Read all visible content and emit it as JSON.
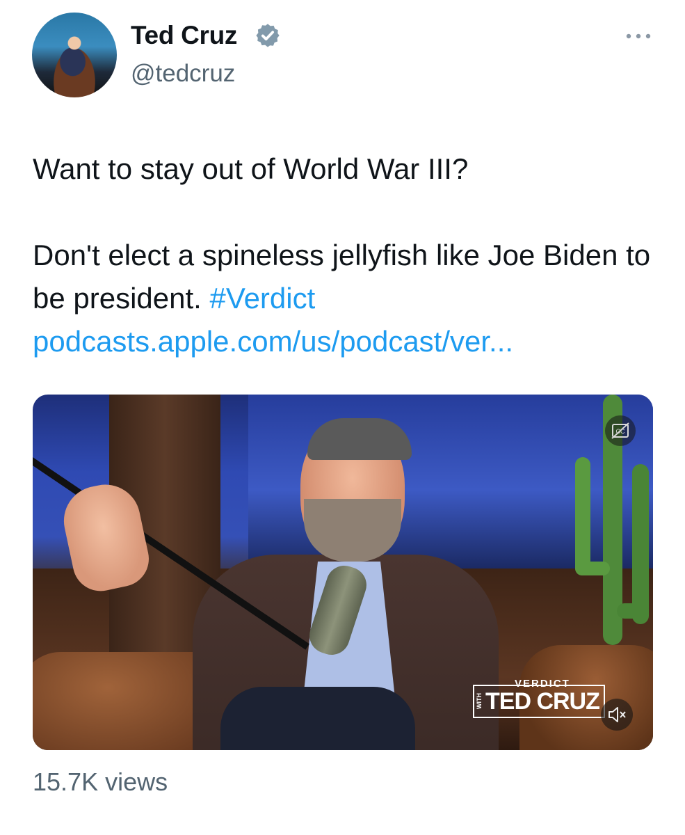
{
  "author": {
    "display_name": "Ted Cruz",
    "handle": "@tedcruz",
    "verified_icon": "verified-badge-icon",
    "avatar_icon": "profile-photo"
  },
  "menu": {
    "more_icon": "more-horizontal-icon"
  },
  "tweet": {
    "text_line1": "Want to stay out of World War III?",
    "text_line2": "Don't elect a spineless jellyfish like Joe Biden to be president.",
    "hashtag": "#Verdict",
    "link": "podcasts.apple.com/us/podcast/ver..."
  },
  "media": {
    "type": "video",
    "logo_top": "VERDICT",
    "logo_side": "WITH",
    "logo_name": "TED CRUZ",
    "cc_icon": "closed-captions-icon",
    "mute_icon": "muted-speaker-icon"
  },
  "stats": {
    "views": "15.7K views"
  },
  "colors": {
    "link": "#1d9bf0",
    "secondary_text": "#536471",
    "verified": "#829aab"
  }
}
